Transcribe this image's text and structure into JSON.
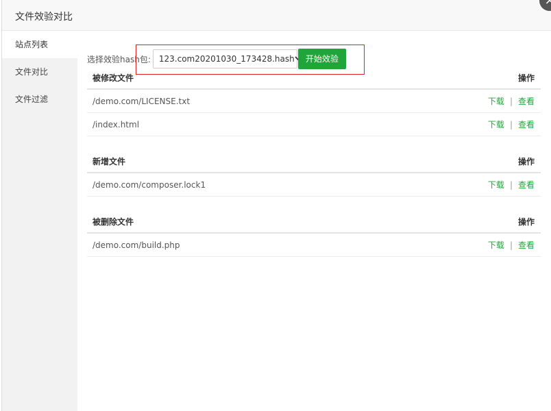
{
  "dialog": {
    "title": "文件效验对比",
    "close_glyph": "×"
  },
  "sidebar": {
    "items": [
      {
        "label": "站点列表"
      },
      {
        "label": "文件对比"
      },
      {
        "label": "文件过滤"
      }
    ]
  },
  "hash": {
    "label": "选择效验hash包:",
    "selected": "123.com20201030_173428.hash",
    "start_label": "开始效验"
  },
  "sections": {
    "modified": {
      "title": "被修改文件",
      "op_header": "操作",
      "rows": [
        {
          "path": "/demo.com/LICENSE.txt"
        },
        {
          "path": "/index.html"
        }
      ]
    },
    "added": {
      "title": "新增文件",
      "op_header": "操作",
      "rows": [
        {
          "path": "/demo.com/composer.lock1"
        }
      ]
    },
    "deleted": {
      "title": "被删除文件",
      "op_header": "操作",
      "rows": [
        {
          "path": "/demo.com/build.php"
        }
      ]
    }
  },
  "ops": {
    "download": "下载",
    "separator": "|",
    "view": "查看"
  },
  "colors": {
    "accent": "#20a53a",
    "highlight": "#e02020"
  }
}
